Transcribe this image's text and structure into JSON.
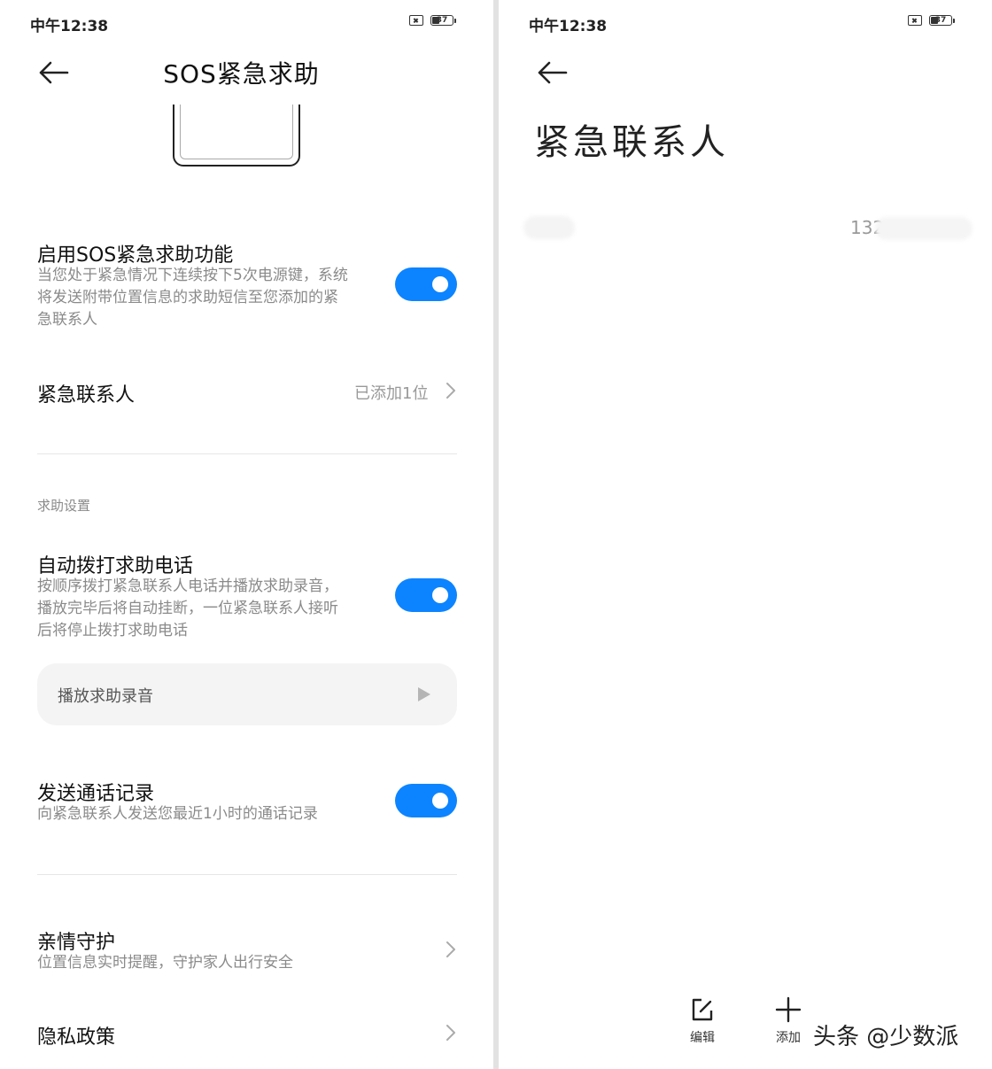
{
  "left": {
    "status": {
      "time": "中午12:38",
      "battery": "37"
    },
    "title": "SOS紧急求助",
    "sos": {
      "title": "启用SOS紧急求助功能",
      "desc1": "当您处于紧急情况下连续按下5次电源键，系统",
      "desc2": "将发送附带位置信息的求助短信至您添加的紧",
      "desc3": "急联系人",
      "enabled": true
    },
    "contacts": {
      "title": "紧急联系人",
      "value": "已添加1位"
    },
    "section_label": "求助设置",
    "auto_call": {
      "title": "自动拨打求助电话",
      "desc1": "按顺序拨打紧急联系人电话并播放求助录音，",
      "desc2": "播放完毕后将自动挂断，一位紧急联系人接听",
      "desc3": "后将停止拨打求助电话",
      "enabled": true
    },
    "play_recording": "播放求助录音",
    "send_log": {
      "title": "发送通话记录",
      "desc": "向紧急联系人发送您最近1小时的通话记录",
      "enabled": true
    },
    "family": {
      "title": "亲情守护",
      "desc": "位置信息实时提醒，守护家人出行安全"
    },
    "privacy": {
      "title": "隐私政策"
    }
  },
  "right": {
    "status": {
      "time": "中午12:38",
      "battery": "37"
    },
    "title": "紧急联系人",
    "contact_number_visible": "132",
    "edit_label": "编辑",
    "add_label": "添加",
    "watermark": "头条 @少数派"
  }
}
